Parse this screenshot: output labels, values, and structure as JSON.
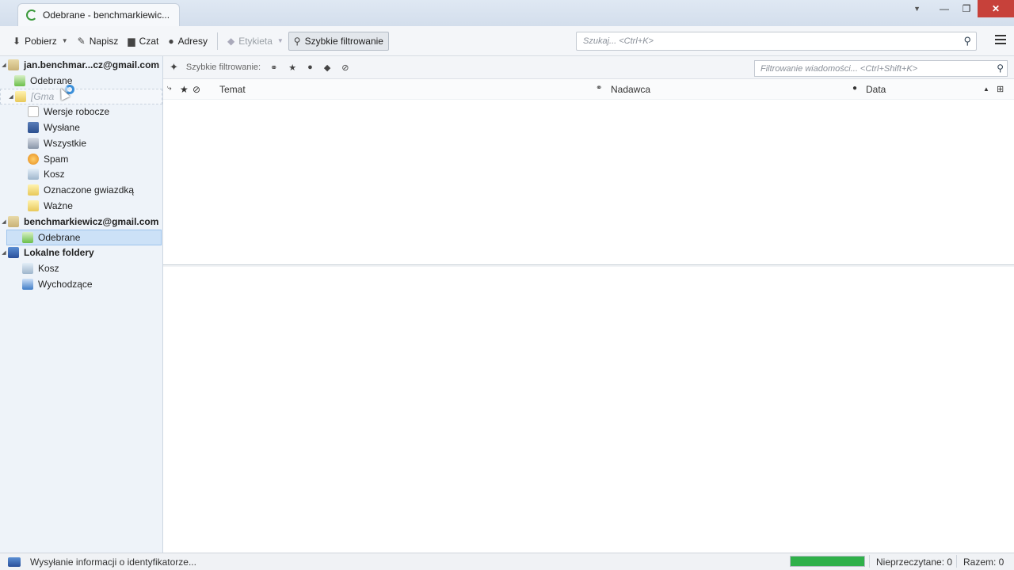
{
  "window": {
    "tab_title": "Odebrane - benchmarkiewic...",
    "min_icon": "minimize-icon",
    "max_icon": "restore-icon",
    "close_icon": "close-icon"
  },
  "toolbar": {
    "get_mail": "Pobierz",
    "write": "Napisz",
    "chat": "Czat",
    "address_book": "Adresy",
    "tag": "Etykieta",
    "quick_filter": "Szybkie filtrowanie",
    "search_placeholder": "Szukaj... <Ctrl+K>"
  },
  "sidebar": {
    "account1": "jan.benchmar...cz@gmail.com",
    "account1_inbox": "Odebrane",
    "gmail_folder": "[Gma",
    "drafts": "Wersje robocze",
    "sent": "Wysłane",
    "all": "Wszystkie",
    "spam": "Spam",
    "trash": "Kosz",
    "starred": "Oznaczone gwiazdką",
    "important": "Ważne",
    "account2": "benchmarkiewicz@gmail.com",
    "account2_inbox": "Odebrane",
    "local": "Lokalne foldery",
    "local_trash": "Kosz",
    "outbox": "Wychodzące"
  },
  "quick_filter_bar": {
    "label": "Szybkie filtrowanie:",
    "filter_placeholder": "Filtrowanie wiadomości... <Ctrl+Shift+K>"
  },
  "columns": {
    "subject": "Temat",
    "sender": "Nadawca",
    "date": "Data"
  },
  "status": {
    "message": "Wysyłanie informacji o identyfikatorze...",
    "progress": 1.0,
    "unread": "Nieprzeczytane: 0",
    "total": "Razem: 0"
  },
  "colors": {
    "selection": "#cce1f7",
    "progress": "#2fb04a",
    "close_button": "#c7413a"
  }
}
